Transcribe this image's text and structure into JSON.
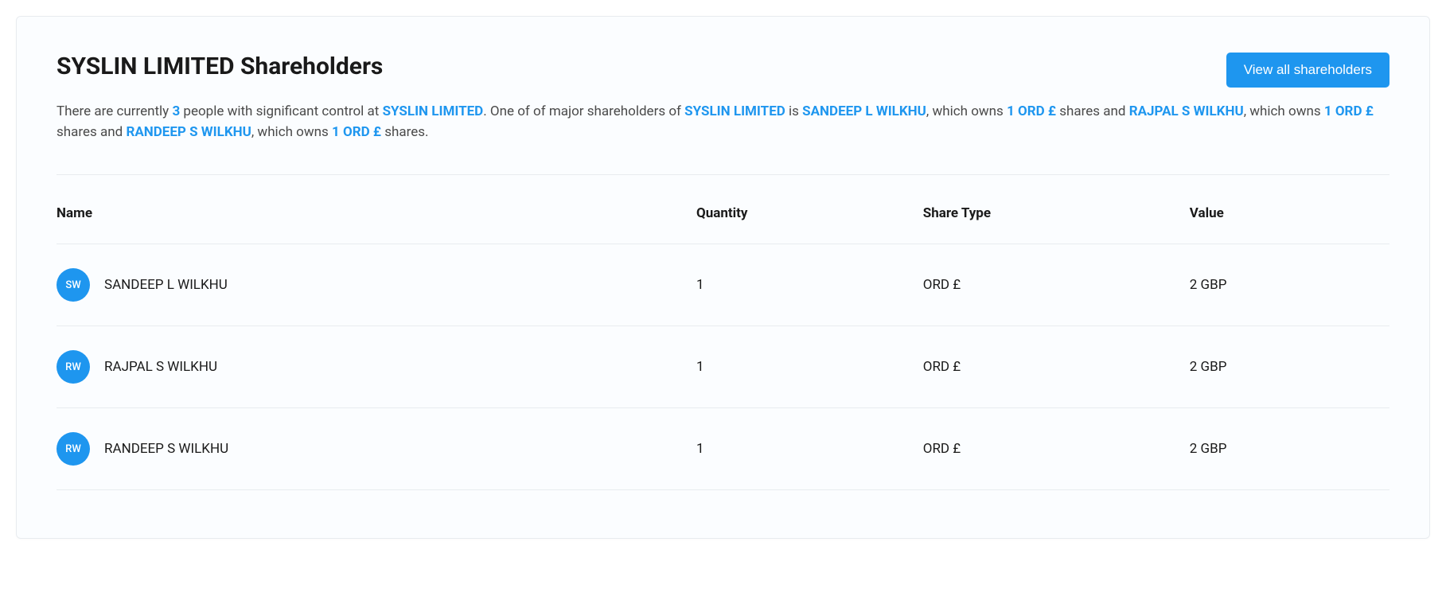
{
  "header": {
    "title": "SYSLIN LIMITED Shareholders",
    "view_all_label": "View all shareholders"
  },
  "description": {
    "prefix": "There are currently ",
    "count": "3",
    "after_count": " people with significant control at ",
    "company": "SYSLIN LIMITED",
    "mid1": ". One of of major shareholders of ",
    "company2": "SYSLIN LIMITED",
    "mid2": " is ",
    "name1": "SANDEEP L WILKHU",
    "mid3": ", which owns ",
    "shares1": "1 ORD £",
    "mid4": " shares and ",
    "name2": "RAJPAL S WILKHU",
    "mid5": ", which owns ",
    "shares2": "1 ORD £",
    "mid6": " shares and ",
    "name3": "RANDEEP S WILKHU",
    "mid7": ", which owns ",
    "shares3": "1 ORD £",
    "suffix": " shares."
  },
  "table": {
    "columns": {
      "name": "Name",
      "quantity": "Quantity",
      "share_type": "Share Type",
      "value": "Value"
    },
    "rows": [
      {
        "initials": "SW",
        "name": "SANDEEP L WILKHU",
        "quantity": "1",
        "share_type": "ORD £",
        "value": "2 GBP"
      },
      {
        "initials": "RW",
        "name": "RAJPAL S WILKHU",
        "quantity": "1",
        "share_type": "ORD £",
        "value": "2 GBP"
      },
      {
        "initials": "RW",
        "name": "RANDEEP S WILKHU",
        "quantity": "1",
        "share_type": "ORD £",
        "value": "2 GBP"
      }
    ]
  }
}
